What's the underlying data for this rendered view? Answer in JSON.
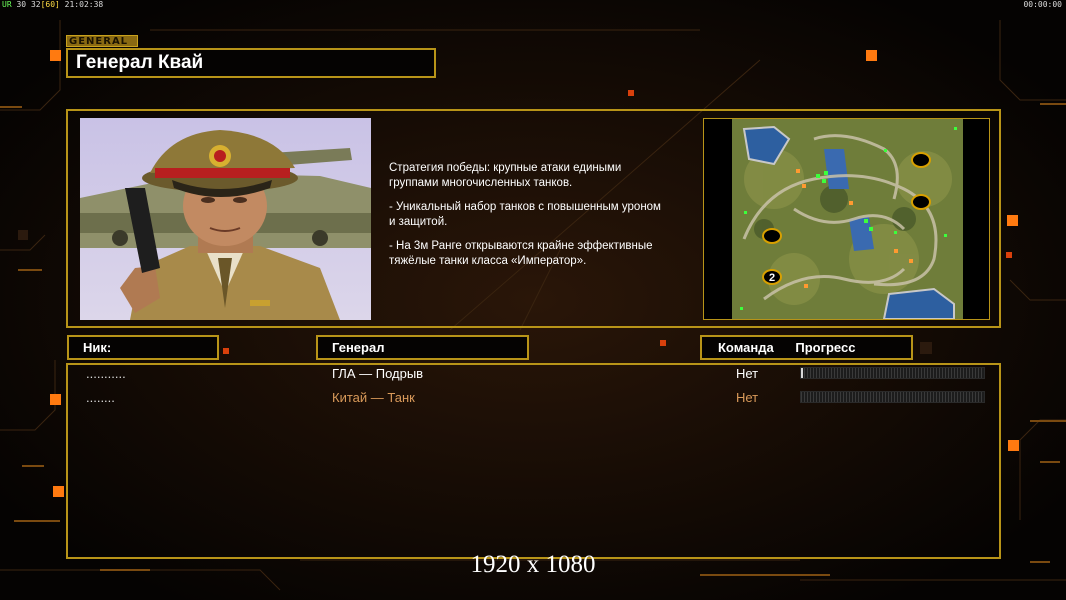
{
  "hud": {
    "left_prefix": "UR",
    "fps": "30",
    "frames": "32",
    "frames_bracket": "[60]",
    "clock": "21:02:38",
    "right_clock": "00:00:00"
  },
  "general_tag": "GENERAL",
  "title": "Генерал Квай",
  "description": [
    "Стратегия победы: крупные атаки едиными\n группами многочисленных танков.",
    "- Уникальный набор танков с повышенным уроном\n и защитой.",
    "- На 3м Ранге открываются крайне эффективные\n тяжёлые танки класса «Император»."
  ],
  "map": {
    "start_position_label": "2"
  },
  "headers": {
    "nick": "Ник:",
    "general": "Генерал",
    "team": "Команда",
    "progress": "Прогресс"
  },
  "players": [
    {
      "nick": "...........",
      "general": "ГЛА — Подрыв",
      "team": "Нет",
      "progress": 0.01,
      "color": "#ffffff"
    },
    {
      "nick": "........",
      "general": "Китай — Танк",
      "team": "Нет",
      "progress": 0.0,
      "color": "#d99a5a"
    }
  ],
  "resolution_label": "1920 x 1080",
  "colors": {
    "accent": "#b89418",
    "background": "#070504",
    "highlight": "#ff6a00"
  }
}
